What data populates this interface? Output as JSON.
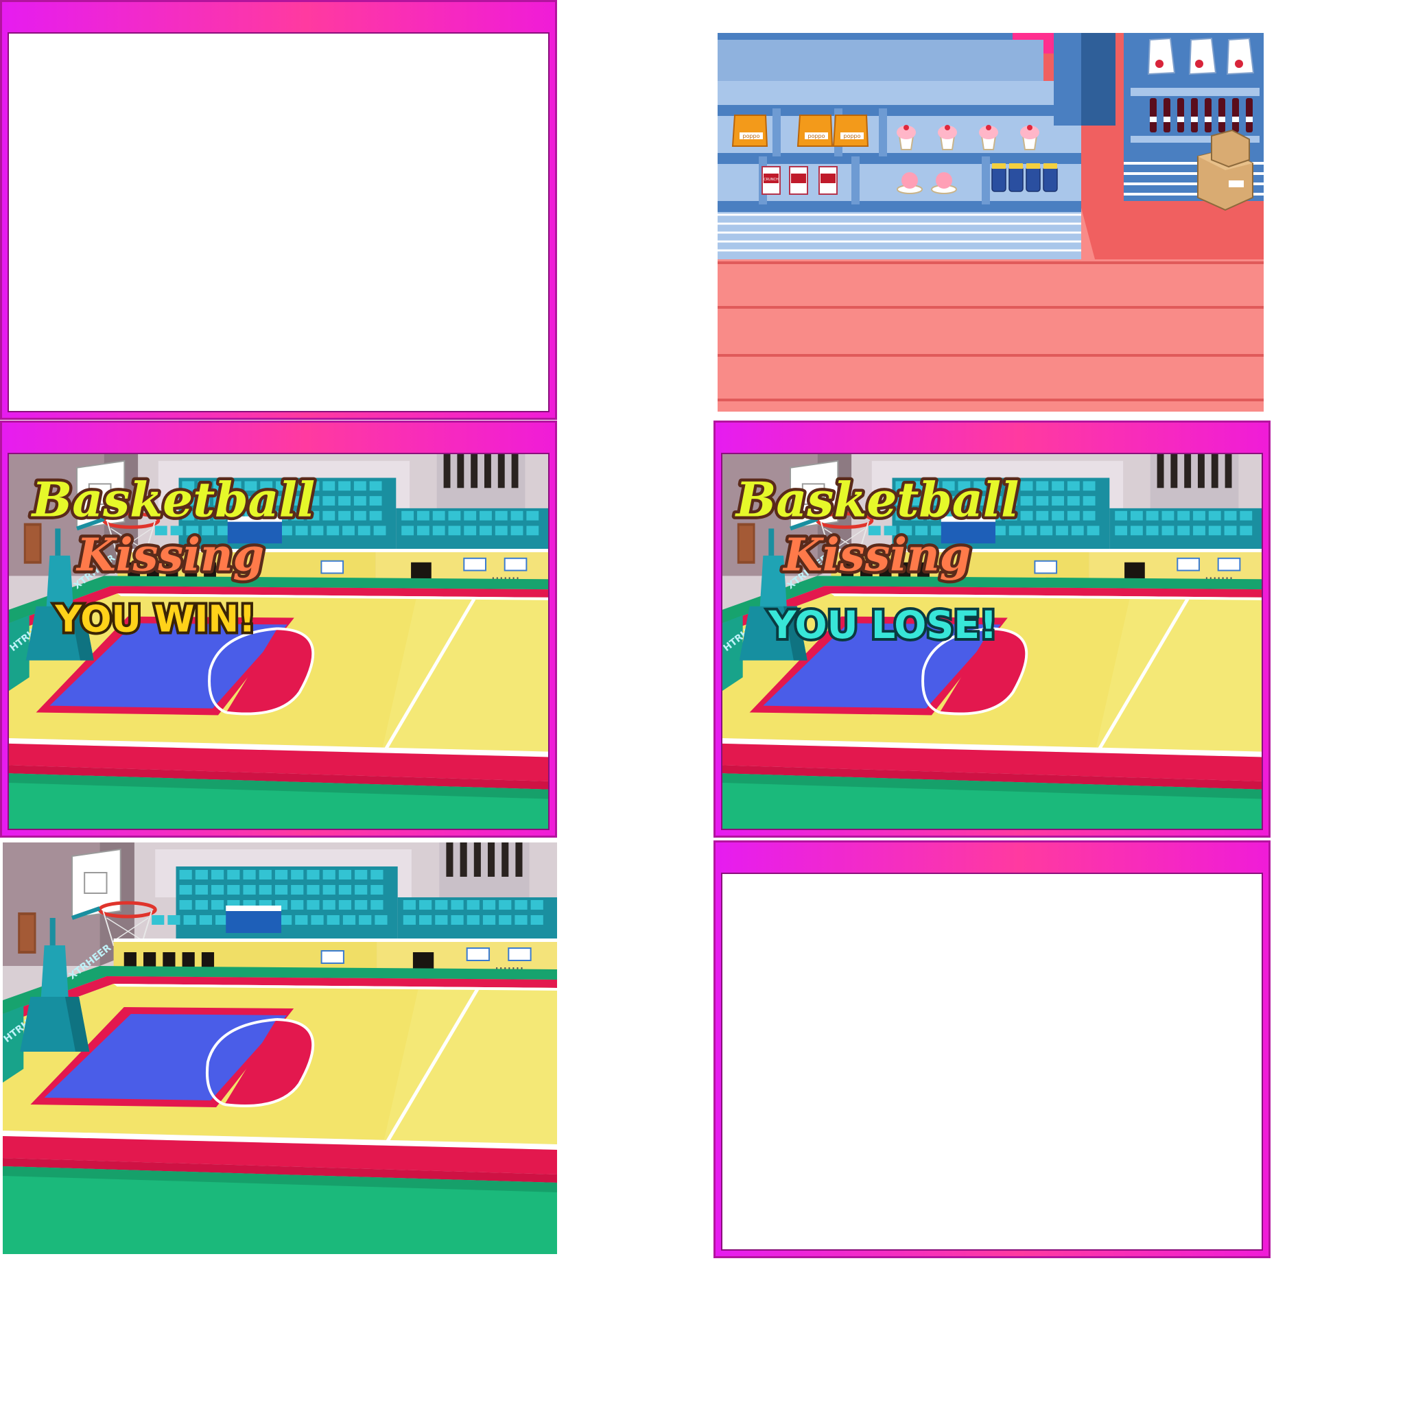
{
  "game": {
    "title_line1": "Basketball",
    "title_line2": "Kissing",
    "win_text": "YOU WIN!",
    "lose_text": "YOU LOSE!"
  },
  "court": {
    "banner_text_left": "HTRH",
    "banner_text_right": "XTRHEER"
  },
  "shop": {
    "chips_label": "poppo",
    "cereal_label": "CRUNCH"
  },
  "colors": {
    "frame_pink": "#ff3aa0",
    "frame_magenta": "#e61cf0",
    "court_yellow": "#f3e46a",
    "court_red": "#e3184e",
    "court_blue": "#4a5de8",
    "floor_green": "#1bb97b",
    "seat_teal": "#2bb8c8",
    "shop_floor": "#f98b88",
    "shelf_blue": "#4a7fc1"
  }
}
